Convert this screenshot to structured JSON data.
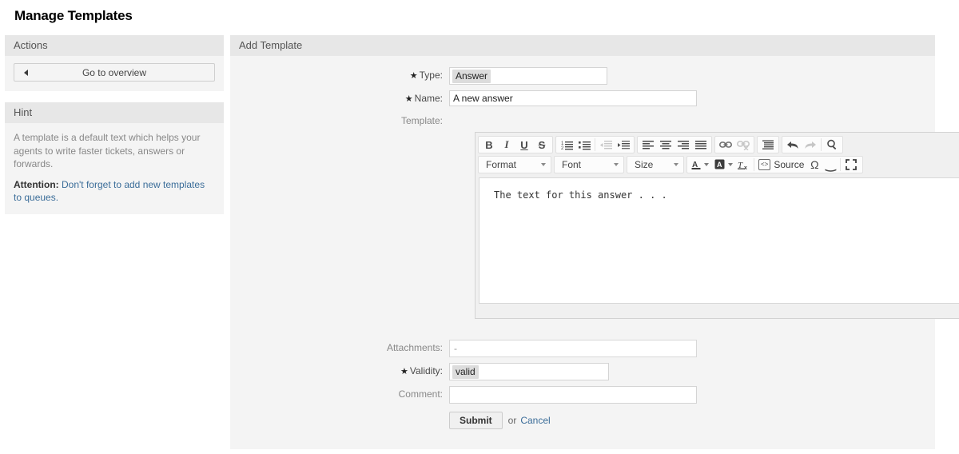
{
  "page": {
    "title": "Manage Templates"
  },
  "sidebar": {
    "actions": {
      "header": "Actions",
      "overview_button": "Go to overview"
    },
    "hint": {
      "header": "Hint",
      "text": "A template is a default text which helps your agents to write faster tickets, answers or forwards.",
      "attention_label": "Attention:",
      "attention_link": "Don't forget to add new templates to queues."
    }
  },
  "main": {
    "header": "Add Template",
    "fields": {
      "type": {
        "label": "Type:",
        "required": true,
        "value": "Answer"
      },
      "name": {
        "label": "Name:",
        "required": true,
        "value": "A new answer"
      },
      "template": {
        "label": "Template:",
        "required": false,
        "content": "The text for this answer . . ."
      },
      "attachments": {
        "label": "Attachments:",
        "required": false,
        "value": "-"
      },
      "validity": {
        "label": "Validity:",
        "required": true,
        "value": "valid"
      },
      "comment": {
        "label": "Comment:",
        "required": false,
        "value": ""
      }
    },
    "actions": {
      "submit_label": "Submit",
      "or_text": "or",
      "cancel_label": "Cancel"
    }
  },
  "editor": {
    "toolbar_row1": [
      {
        "name": "bold",
        "glyph": "B",
        "disabled": false
      },
      {
        "name": "italic",
        "glyph": "I",
        "disabled": false
      },
      {
        "name": "underline",
        "glyph": "U",
        "disabled": false
      },
      {
        "name": "strikethrough",
        "glyph": "S",
        "disabled": false
      },
      {
        "name": "numbered-list",
        "glyph": "",
        "disabled": false
      },
      {
        "name": "bulleted-list",
        "glyph": "",
        "disabled": false
      },
      {
        "name": "decrease-indent",
        "glyph": "",
        "disabled": true
      },
      {
        "name": "increase-indent",
        "glyph": "",
        "disabled": false
      },
      {
        "name": "align-left",
        "glyph": "",
        "disabled": false
      },
      {
        "name": "align-center",
        "glyph": "",
        "disabled": false
      },
      {
        "name": "align-right",
        "glyph": "",
        "disabled": false
      },
      {
        "name": "align-justify",
        "glyph": "",
        "disabled": false
      },
      {
        "name": "link",
        "glyph": "",
        "disabled": false
      },
      {
        "name": "unlink",
        "glyph": "",
        "disabled": true
      },
      {
        "name": "blockquote",
        "glyph": "",
        "disabled": false
      },
      {
        "name": "undo",
        "glyph": "",
        "disabled": false
      },
      {
        "name": "redo",
        "glyph": "",
        "disabled": true
      },
      {
        "name": "find",
        "glyph": "",
        "disabled": false
      }
    ],
    "selects": {
      "format": "Format",
      "font": "Font",
      "size": "Size"
    },
    "row2_buttons": {
      "text_color": "A",
      "background_color": "A",
      "remove_format": "Tx",
      "source": "Source",
      "special_char": "Ω",
      "quotes": "⹂",
      "maximize": "maximize"
    }
  },
  "colors": {
    "link": "#3b6d99",
    "panel_header": "#e7e7e7",
    "panel_body": "#f4f4f4",
    "chip": "#dcdcdc",
    "muted_text": "#888888"
  }
}
